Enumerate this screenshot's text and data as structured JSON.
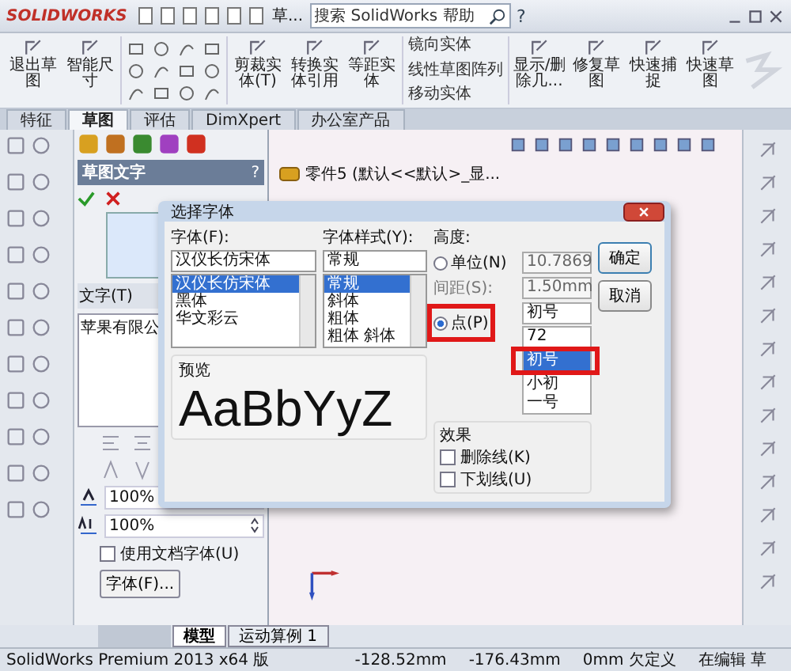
{
  "app": {
    "logo": "SOLIDWORKS",
    "doc_title": "草...",
    "search": {
      "placeholder": "搜索 SolidWorks 帮助"
    },
    "help": "?"
  },
  "ribbon": [
    {
      "label": "退出草图",
      "kind": "large"
    },
    {
      "label": "智能尺寸",
      "kind": "large"
    },
    {
      "kind": "tools"
    },
    {
      "label": "剪裁实体(T)",
      "kind": "large"
    },
    {
      "label": "转换实体引用",
      "kind": "large"
    },
    {
      "label": "等距实体",
      "kind": "large"
    },
    {
      "kind": "stack",
      "items": [
        "镜向实体",
        "线性草图阵列",
        "移动实体"
      ]
    },
    {
      "label": "显示/删除几...",
      "kind": "large"
    },
    {
      "label": "修复草图",
      "kind": "large"
    },
    {
      "label": "快速捕捉",
      "kind": "large"
    },
    {
      "label": "快速草图",
      "kind": "large"
    }
  ],
  "tabs": [
    {
      "label": "特征",
      "selected": false
    },
    {
      "label": "草图",
      "selected": true
    },
    {
      "label": "评估",
      "selected": false
    },
    {
      "label": "DimXpert",
      "selected": false
    },
    {
      "label": "办公室产品",
      "selected": false
    }
  ],
  "property_manager": {
    "title": "草图文字",
    "help": "?",
    "text_label": "文字(T)",
    "text_value": "苹果有限公",
    "width_scale": "100%",
    "spacing_scale": "100%",
    "use_doc_font": {
      "label": "使用文档字体(U)",
      "checked": false
    },
    "font_button": "字体(F)..."
  },
  "tree": {
    "root": "零件5 (默认<<默认>_显..."
  },
  "dialog": {
    "title": "选择字体",
    "font": {
      "label": "字体(F):",
      "value": "汉仪长仿宋体",
      "options": [
        {
          "label": "汉仪长仿宋体",
          "selected": true
        },
        {
          "label": "黑体",
          "selected": false
        },
        {
          "label": "华文彩云",
          "selected": false
        }
      ]
    },
    "style": {
      "label": "字体样式(Y):",
      "value": "常规",
      "options": [
        {
          "label": "常规",
          "selected": true
        },
        {
          "label": "斜体",
          "selected": false
        },
        {
          "label": "粗体",
          "selected": false
        },
        {
          "label": "粗体 斜体",
          "selected": false
        }
      ]
    },
    "height": {
      "label": "高度:",
      "unit": {
        "label": "单位(N)",
        "selected": false,
        "value": "10.7869"
      },
      "spacing": {
        "label": "间距(S):",
        "value": "1.50mm"
      },
      "point": {
        "label": "点(P)",
        "selected": true,
        "value": "初号",
        "options": [
          {
            "label": "72",
            "selected": false
          },
          {
            "label": "初号",
            "selected": true
          },
          {
            "label": "小初",
            "selected": false
          },
          {
            "label": "一号",
            "selected": false
          }
        ]
      }
    },
    "preview": {
      "label": "预览",
      "sample": "AaBbYyZ"
    },
    "effects": {
      "label": "效果",
      "items": [
        {
          "label": "删除线(K)",
          "checked": false
        },
        {
          "label": "下划线(U)",
          "checked": false
        }
      ]
    },
    "buttons": [
      "确定",
      "取消"
    ]
  },
  "bottom_tabs": [
    {
      "label": "模型",
      "selected": true
    },
    {
      "label": "运动算例 1",
      "selected": false
    }
  ],
  "status_bar": [
    "SolidWorks Premium 2013 x64 版",
    "-128.52mm",
    "-176.43mm",
    "0mm 欠定义",
    "在编辑 草"
  ]
}
